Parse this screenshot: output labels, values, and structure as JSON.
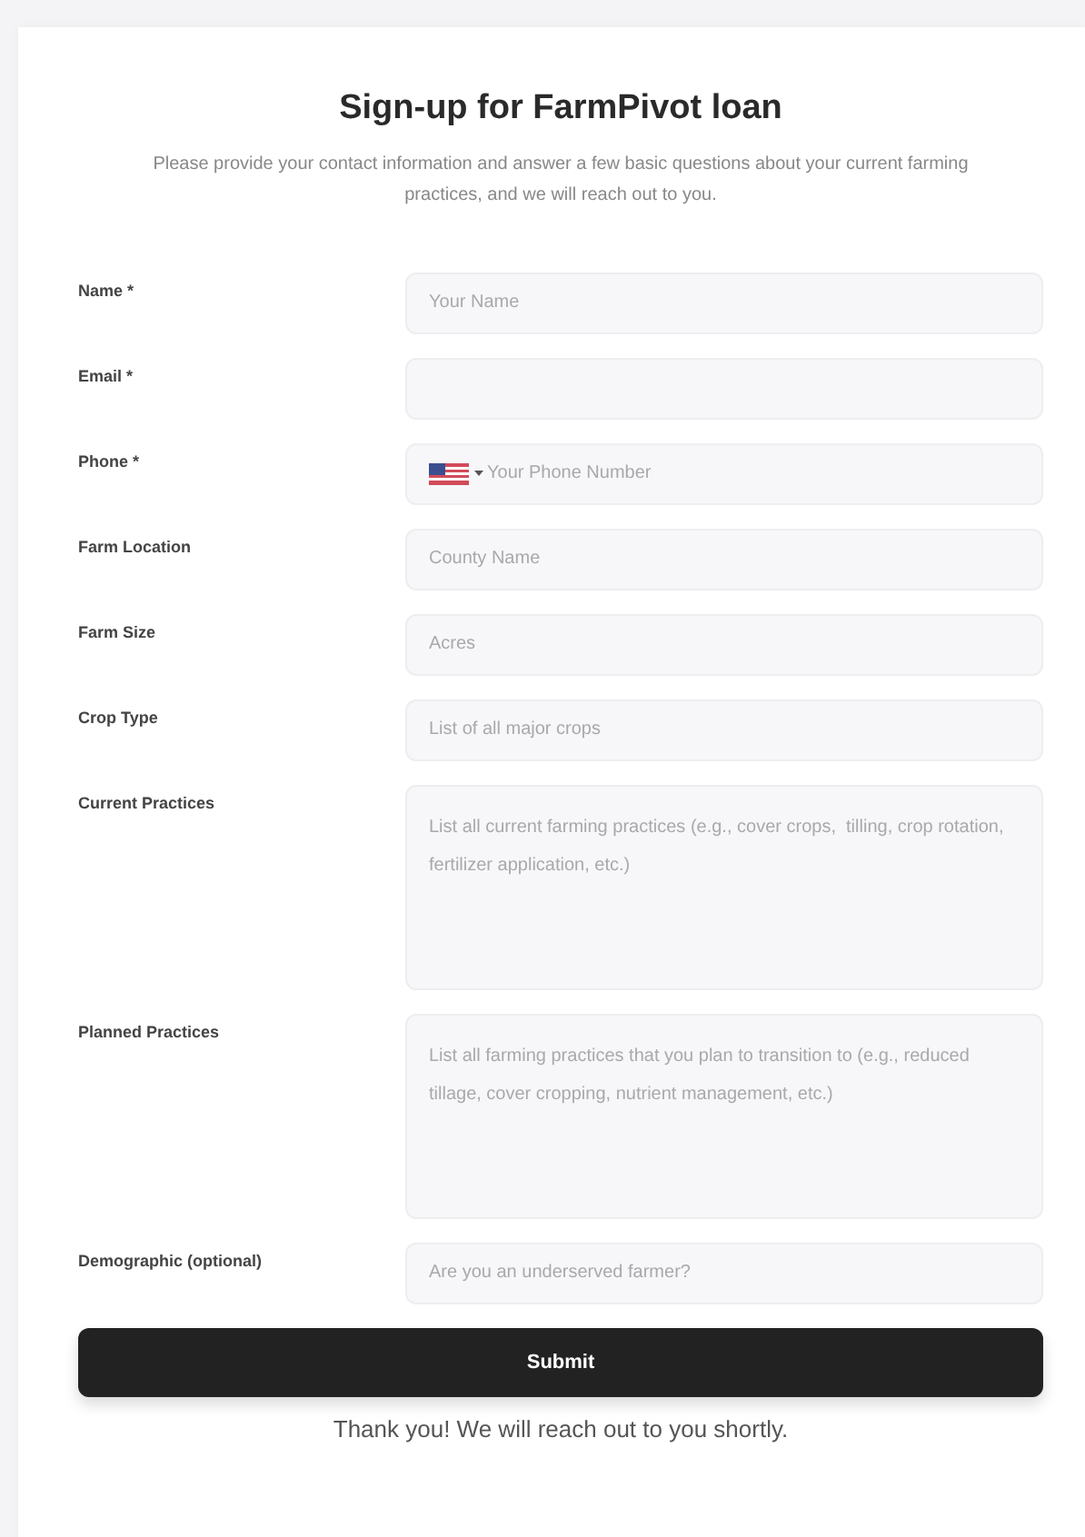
{
  "title": "Sign-up for FarmPivot loan",
  "intro": "Please provide your contact information and answer a few basic questions about your current farming practices, and we will reach out to you.",
  "fields": [
    {
      "label": "Name *",
      "kind": "text",
      "placeholder": "Your Name"
    },
    {
      "label": "Email *",
      "kind": "text"
    },
    {
      "label": "Phone *",
      "kind": "phone",
      "placeholder": "Your Phone Number"
    },
    {
      "label": "Farm Location",
      "kind": "text",
      "placeholder": "County Name"
    },
    {
      "label": "Farm Size",
      "kind": "text",
      "placeholder": "Acres"
    },
    {
      "label": "Crop Type",
      "kind": "text",
      "placeholder": "List of all major crops"
    },
    {
      "label": "Current Practices",
      "kind": "textarea",
      "placeholder": "List all current farming practices (e.g., cover crops,  tilling, crop rotation, fertilizer application, etc.)"
    },
    {
      "label": "Planned Practices",
      "kind": "textarea",
      "placeholder": "List all farming practices that you plan to transition to (e.g., reduced tillage, cover cropping, nutrient management, etc.)"
    },
    {
      "label": "Demographic (optional)",
      "kind": "text",
      "placeholder": "Are you an underserved farmer?"
    }
  ],
  "submit": "Submit",
  "thanks": "Thank you! We will reach out to you shortly."
}
